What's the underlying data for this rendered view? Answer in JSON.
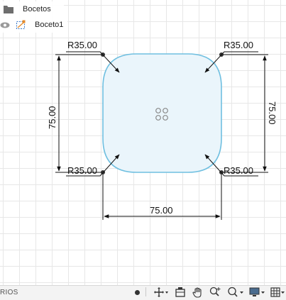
{
  "browser": {
    "folder": {
      "label": "Bocetos",
      "icon": "folder-icon"
    },
    "sketch": {
      "label": "Boceto1",
      "icon": "sketch-icon",
      "visibility_icon": "eye-icon"
    }
  },
  "sketch": {
    "radius_labels": [
      "R35.00",
      "R35.00",
      "R35.00",
      "R35.00"
    ],
    "dim_left": "75.00",
    "dim_right": "75.00",
    "dim_bottom": "75.00"
  },
  "statusbar": {
    "label": "RIOS"
  },
  "toolbar": {
    "icons": [
      "record-dot-icon",
      "timeline-marker-icon",
      "orbit-icon",
      "look-at-icon",
      "pan-hand-icon",
      "zoom-window-icon",
      "zoom-icon",
      "display-settings-icon",
      "grid-icon"
    ]
  },
  "colors": {
    "profile_fill": "#eaf5fb",
    "profile_stroke": "#6fbfe0",
    "dimension": "#1a1a1a"
  }
}
